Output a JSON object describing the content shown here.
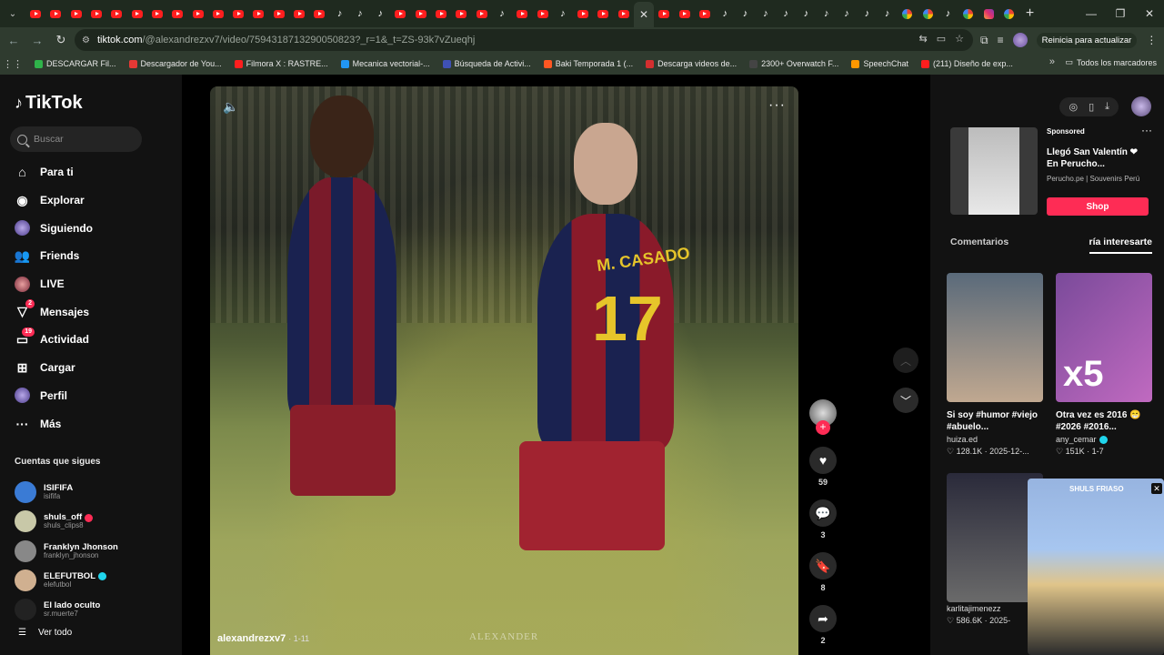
{
  "browser": {
    "tabs": [
      "yt",
      "yt",
      "yt",
      "yt",
      "yt",
      "yt",
      "yt",
      "yt",
      "yt",
      "yt",
      "yt",
      "yt",
      "yt",
      "yt",
      "yt",
      "tt",
      "tt",
      "tt",
      "yt",
      "yt",
      "yt",
      "yt",
      "yt",
      "tt",
      "yt",
      "yt",
      "tt",
      "yt",
      "yt",
      "yt",
      "close",
      "yt",
      "yt",
      "yt",
      "tt",
      "tt",
      "tt",
      "tt",
      "tt",
      "tt",
      "tt",
      "tt",
      "tt",
      "g",
      "g",
      "tt",
      "g",
      "ig",
      "g"
    ],
    "url_host": "tiktok.com",
    "url_path": "/@alexandrezxv7/video/7594318713290050823?_r=1&_t=ZS-93k7vZueqhj",
    "update_label": "Reinicia para actualizar",
    "bookmarks": [
      {
        "label": "DESCARGAR Fil...",
        "color": "#2fb34a"
      },
      {
        "label": "Descargador de You...",
        "color": "#e53935"
      },
      {
        "label": "Filmora X : RASTRE...",
        "color": "#ff1e1e"
      },
      {
        "label": "Mecanica vectorial-...",
        "color": "#2196f3"
      },
      {
        "label": "Búsqueda de Activi...",
        "color": "#3f51b5"
      },
      {
        "label": "Baki Temporada 1 (...",
        "color": "#ff5722"
      },
      {
        "label": "Descarga videos de...",
        "color": "#d32f2f"
      },
      {
        "label": "2300+ Overwatch F...",
        "color": "#444"
      },
      {
        "label": "SpeechChat",
        "color": "#ff9800"
      },
      {
        "label": "(211) Diseño de exp...",
        "color": "#ff1e1e"
      }
    ],
    "all_bookmarks": "Todos los marcadores"
  },
  "tiktok": {
    "logo": "TikTok",
    "search_placeholder": "Buscar",
    "nav": [
      {
        "label": "Para ti",
        "icon": "home-icon",
        "glyph": "⌂"
      },
      {
        "label": "Explorar",
        "icon": "compass-icon",
        "glyph": "◉"
      },
      {
        "label": "Siguiendo",
        "icon": "following-avatar-icon",
        "glyph": ""
      },
      {
        "label": "Friends",
        "icon": "friends-icon",
        "glyph": "👥"
      },
      {
        "label": "LIVE",
        "icon": "live-icon",
        "glyph": ""
      },
      {
        "label": "Mensajes",
        "icon": "messages-icon",
        "glyph": "▽",
        "badge": "2"
      },
      {
        "label": "Actividad",
        "icon": "activity-icon",
        "glyph": "▭",
        "badge": "19"
      },
      {
        "label": "Cargar",
        "icon": "upload-icon",
        "glyph": "⊞"
      },
      {
        "label": "Perfil",
        "icon": "profile-icon",
        "glyph": ""
      },
      {
        "label": "Más",
        "icon": "more-icon",
        "glyph": "···"
      }
    ],
    "following_title": "Cuentas que sigues",
    "following": [
      {
        "name": "ISIFIFA",
        "user": "isififa",
        "color": "#3a7bd5",
        "mark": ""
      },
      {
        "name": "shuls_off",
        "user": "shuls_clips8",
        "color": "#c8c8a8",
        "mark": "live"
      },
      {
        "name": "Franklyn Jhonson",
        "user": "franklyn_jhonson",
        "color": "#888",
        "mark": ""
      },
      {
        "name": "ELEFUTBOL",
        "user": "elefutbol",
        "color": "#d0b090",
        "mark": "verified"
      },
      {
        "name": "El lado oculto",
        "user": "sr.muerte7",
        "color": "#222",
        "mark": ""
      }
    ],
    "see_all": "Ver todo"
  },
  "video": {
    "author": "alexandrezxv7",
    "date": "· 1-11",
    "jersey_name": "M. CASADO",
    "jersey_number": "17",
    "watermark": "ALEXANDER",
    "actions": {
      "likes": "59",
      "comments": "3",
      "saves": "8",
      "shares": "2"
    }
  },
  "rightcol": {
    "ad": {
      "sponsored": "Sponsored",
      "title": "Llegó San Valentín ❤ En Perucho...",
      "brand": "Perucho.pe | Souvenirs Perú",
      "shop": "Shop"
    },
    "tabs": [
      "Comentarios",
      "ría interesarte"
    ],
    "cards": [
      {
        "title": "Si soy #humor #viejo #abuelo...",
        "user": "huiza.ed",
        "stats": "♡ 128.1K · 2025-12-...",
        "bg": "linear-gradient(#5a6a7a,#c0a890)",
        "big": "",
        "verified": false
      },
      {
        "title": "Otra vez es 2016 😁 #2026 #2016...",
        "user": "any_cemar",
        "stats": "♡ 151K · 1-7",
        "bg": "linear-gradient(135deg,#7a4a9a,#c06ac0)",
        "big": "x5",
        "verified": true
      },
      {
        "title": "",
        "user": "karlitajimenezz",
        "stats": "♡ 586.6K · 2025-",
        "bg": "linear-gradient(#2a2a3a,#6a6a6a)",
        "big": "",
        "verified": false
      }
    ],
    "pip_label": "SHULS FRIASO"
  }
}
